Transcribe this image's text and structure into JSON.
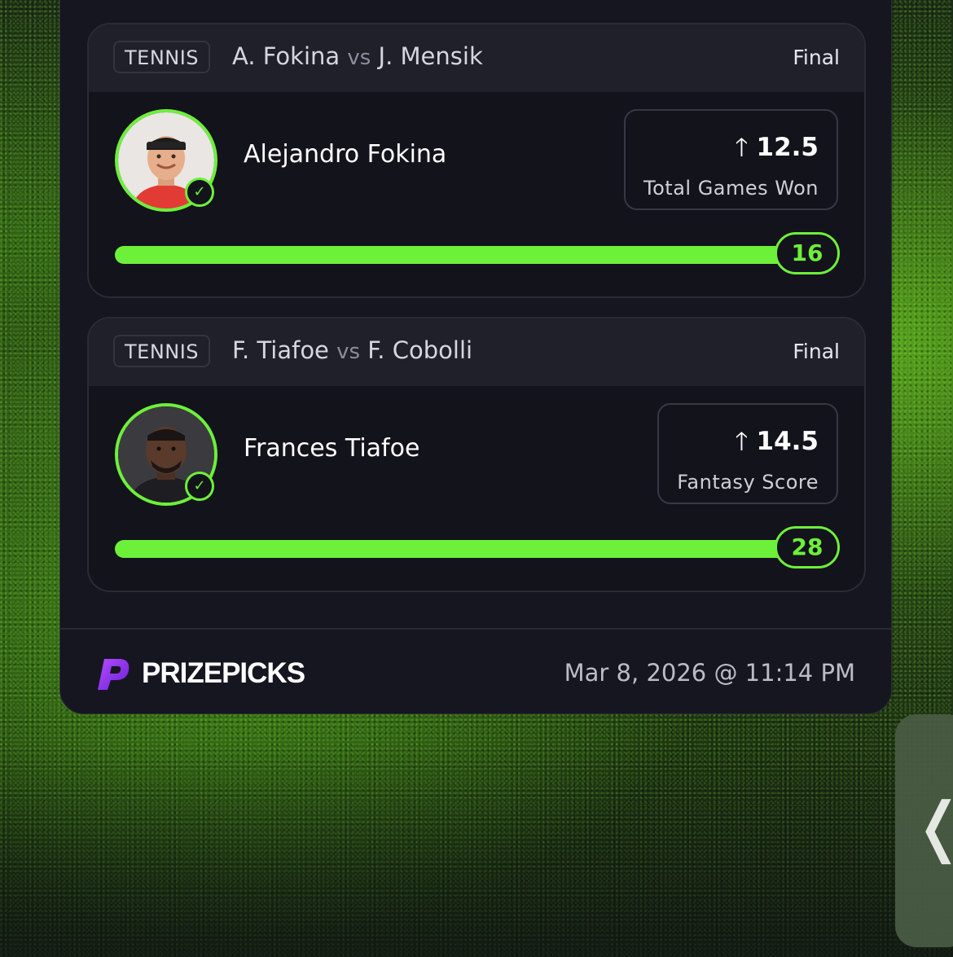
{
  "picks": [
    {
      "sport": "TENNIS",
      "team_a": "A. Fokina",
      "vs": "vs",
      "team_b": "J. Mensik",
      "status": "Final",
      "player": "Alejandro Fokina",
      "direction_icon": "arrow-up-icon",
      "line": "12.5",
      "stat": "Total Games Won",
      "actual": "16",
      "progress_fraction": 1.0
    },
    {
      "sport": "TENNIS",
      "team_a": "F. Tiafoe",
      "vs": "vs",
      "team_b": "F. Cobolli",
      "status": "Final",
      "player": "Frances Tiafoe",
      "direction_icon": "arrow-up-icon",
      "line": "14.5",
      "stat": "Fantasy Score",
      "actual": "28",
      "progress_fraction": 1.0
    }
  ],
  "footer": {
    "brand": "PRIZEPICKS",
    "timestamp": "Mar 8, 2026 @ 11:14 PM"
  },
  "colors": {
    "accent": "#6df03a",
    "brand_purple": "#8a2be2",
    "panel": "#161621"
  }
}
